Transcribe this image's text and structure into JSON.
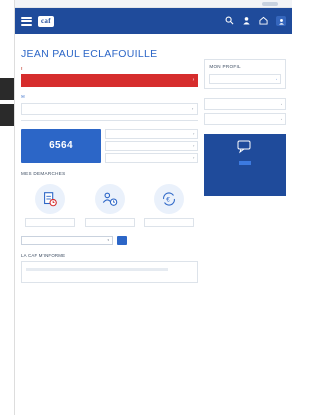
{
  "topbar": {
    "links": [
      "",
      "",
      ""
    ],
    "right_label": ""
  },
  "navbar": {
    "logo": "caf",
    "brand_line1": "",
    "brand_line2": "",
    "icons": [
      {
        "name": "search-icon",
        "label": ""
      },
      {
        "name": "user-icon",
        "label": ""
      },
      {
        "name": "home-icon",
        "label": ""
      },
      {
        "name": "account-icon",
        "label": ""
      }
    ]
  },
  "breadcrumb": "",
  "header_right": "",
  "page_title": "JEAN PAUL ECLAFOUILLE",
  "alerts": {
    "heading": "",
    "message": ""
  },
  "courrier": {
    "heading": "",
    "row_text": ""
  },
  "paiements": {
    "heading": "",
    "card_label": "",
    "amount": "6564",
    "card_sub": "",
    "items": [
      "",
      "",
      ""
    ],
    "footer_label": "",
    "footer_value": ""
  },
  "demarches": {
    "heading": "MES DEMARCHES",
    "items": [
      {
        "icon": "document-clock-icon",
        "label": ""
      },
      {
        "icon": "people-clock-icon",
        "label": ""
      },
      {
        "icon": "euro-refresh-icon",
        "label": ""
      }
    ]
  },
  "attestations": {
    "heading": "",
    "subtitle": "",
    "select_placeholder": "",
    "button": ""
  },
  "catalogue": {
    "heading": "LA CAF M'INFORME",
    "item": ""
  },
  "profil": {
    "heading": "MON PROFIL",
    "fields": [
      {
        "label": "",
        "value": ""
      },
      {
        "label": "",
        "value": ""
      },
      {
        "label": "",
        "value": ""
      },
      {
        "label": "",
        "value": ""
      },
      {
        "label": "",
        "value": ""
      }
    ],
    "button": ""
  },
  "ressources": {
    "heading": "",
    "items": [
      "",
      ""
    ]
  },
  "promo": {
    "text": "",
    "button": ""
  },
  "colors": {
    "brand_blue": "#1f4b9b",
    "accent_blue": "#2c66c7",
    "alert_red": "#d62d2d"
  }
}
